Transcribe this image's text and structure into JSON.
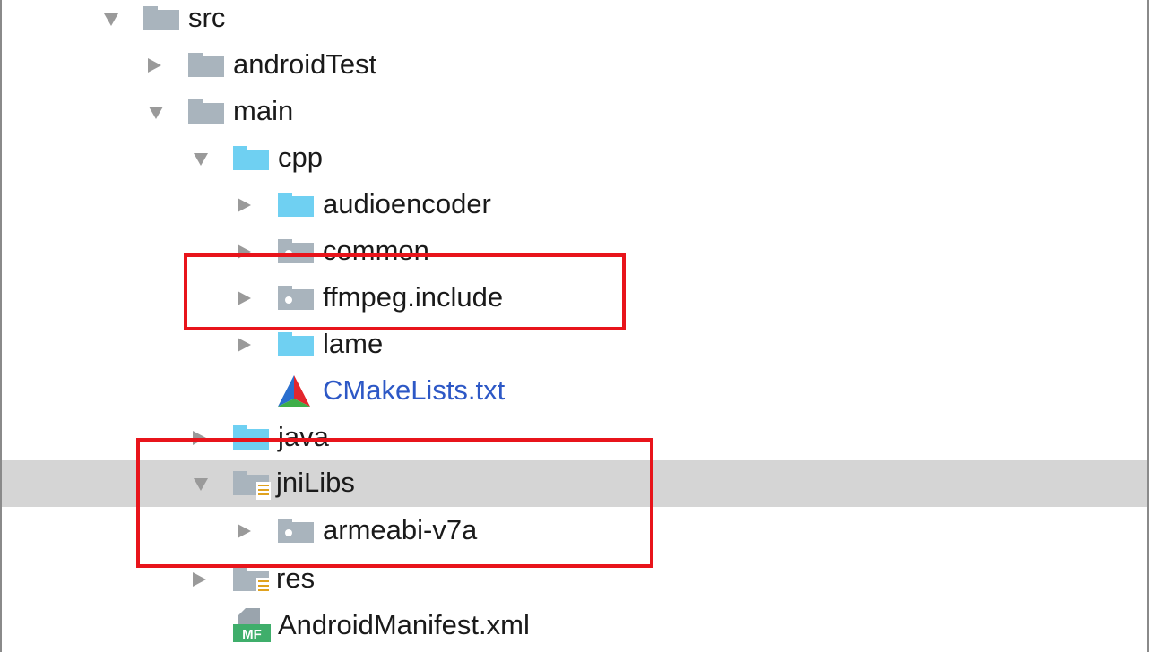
{
  "tree": {
    "src": "src",
    "androidTest": "androidTest",
    "main": "main",
    "cpp": "cpp",
    "audioencoder": "audioencoder",
    "common": "common",
    "ffmpeg_include": "ffmpeg.include",
    "lame": "lame",
    "cmakelists": "CMakeLists.txt",
    "java": "java",
    "jniLibs": "jniLibs",
    "armeabi": "armeabi-v7a",
    "res": "res",
    "manifest": "AndroidManifest.xml"
  },
  "icons": {
    "manifest_badge": "MF"
  },
  "colors": {
    "folder_grey": "#a9b4bd",
    "folder_blue": "#6fd0f2",
    "link_text": "#2d58c6",
    "highlight": "#e8141b",
    "selection": "#d5d5d5"
  }
}
